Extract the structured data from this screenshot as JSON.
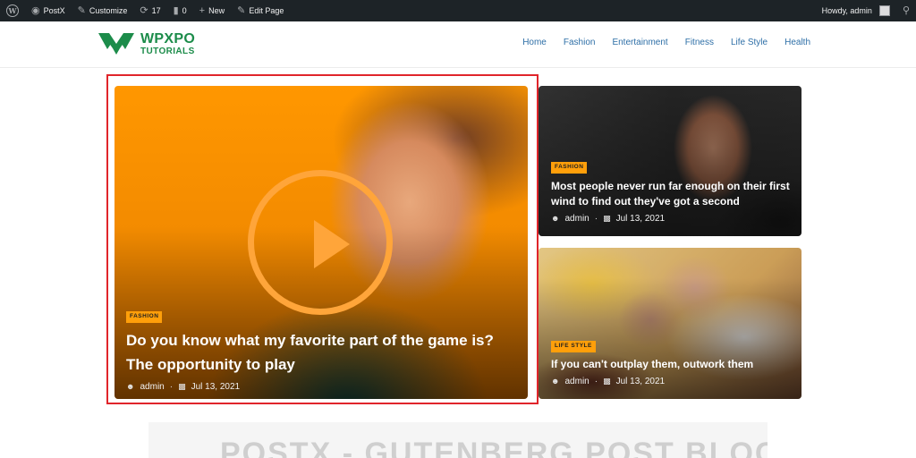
{
  "admin_bar": {
    "site_name": "PostX",
    "customize": "Customize",
    "updates_count": "17",
    "comments_count": "0",
    "new_label": "New",
    "edit_page": "Edit Page",
    "howdy": "Howdy, admin"
  },
  "header": {
    "logo_line1": "WPXPO",
    "logo_line2": "TUTORIALS",
    "nav": [
      "Home",
      "Fashion",
      "Entertainment",
      "Fitness",
      "Life Style",
      "Health"
    ]
  },
  "posts": {
    "main": {
      "category": "FASHION",
      "title": "Do you know what my favorite part of the game is? The opportunity to play",
      "author": "admin",
      "date": "Jul 13, 2021"
    },
    "top": {
      "category": "FASHION",
      "title": "Most people never run far enough on their first wind to find out they've got a second",
      "author": "admin",
      "date": "Jul 13, 2021"
    },
    "bottom": {
      "category": "LIFE STYLE",
      "title": "If you can't outplay them, outwork them",
      "author": "admin",
      "date": "Jul 13, 2021"
    }
  },
  "banner": {
    "text": "POSTX - GUTENBERG POST BLOCKS"
  },
  "colors": {
    "accent": "#ff9f0a",
    "nav_link": "#2271b1",
    "brand_green": "#1c8c4a",
    "highlight_border": "#e0252b"
  }
}
